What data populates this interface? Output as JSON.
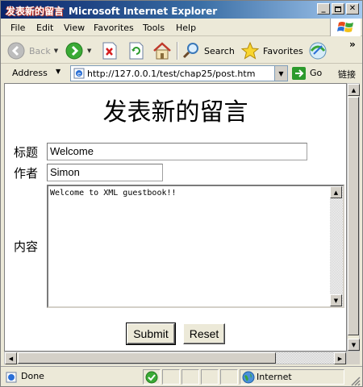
{
  "window": {
    "page_title": "发表新的留言",
    "app_title": "Microsoft Internet Explorer"
  },
  "menu": [
    "File",
    "Edit",
    "View",
    "Favorites",
    "Tools",
    "Help"
  ],
  "toolbar": {
    "back_label": "Back",
    "search_label": "Search",
    "favorites_label": "Favorites",
    "more_label": "»"
  },
  "address": {
    "label": "Address",
    "url": "http://127.0.0.1/test/chap25/post.htm",
    "go_label": "Go",
    "links_label": "链接"
  },
  "form": {
    "heading": "发表新的留言",
    "title_label": "标题",
    "title_value": "Welcome",
    "author_label": "作者",
    "author_value": "Simon",
    "content_label": "内容",
    "content_value": "Welcome to XML guestbook!!",
    "submit_label": "Submit",
    "reset_label": "Reset"
  },
  "status": {
    "text": "Done",
    "zone": "Internet"
  },
  "colors": {
    "titlebar_start": "#0a246a",
    "titlebar_end": "#a6caf0",
    "chrome": "#ece9d8"
  }
}
